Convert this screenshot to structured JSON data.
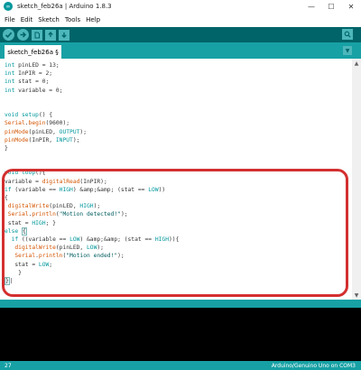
{
  "window": {
    "title": "sketch_feb26a | Arduino 1.8.3",
    "icon_text": "∞",
    "controls": [
      "—",
      "☐",
      "✕"
    ]
  },
  "menu": [
    "File",
    "Edit",
    "Sketch",
    "Tools",
    "Help"
  ],
  "toolbar": {
    "buttons": [
      "verify-icon",
      "upload-icon",
      "new-icon",
      "open-icon",
      "save-icon"
    ],
    "serial_monitor_icon": "magnifier-icon"
  },
  "tab": {
    "label": "sketch_feb26a §",
    "menu_icon": "▼"
  },
  "code_lines": [
    [
      [
        "kw",
        "int"
      ],
      [
        "p",
        " pinLED = 13;"
      ]
    ],
    [
      [
        "kw",
        "int"
      ],
      [
        "p",
        " InPIR = 2;"
      ]
    ],
    [
      [
        "kw",
        "int"
      ],
      [
        "p",
        " stat = 0;"
      ]
    ],
    [
      [
        "kw",
        "int"
      ],
      [
        "p",
        " variable = 0;"
      ]
    ],
    [],
    [],
    [
      [
        "kw",
        "void"
      ],
      [
        "p",
        " "
      ],
      [
        "kw",
        "setup"
      ],
      [
        "p",
        "() {"
      ]
    ],
    [
      [
        "fn",
        "Serial"
      ],
      [
        "p",
        "."
      ],
      [
        "fn",
        "begin"
      ],
      [
        "p",
        "(9600);"
      ]
    ],
    [
      [
        "fn",
        "pinMode"
      ],
      [
        "p",
        "(pinLED, "
      ],
      [
        "ct",
        "OUTPUT"
      ],
      [
        "p",
        ");"
      ]
    ],
    [
      [
        "fn",
        "pinMode"
      ],
      [
        "p",
        "(InPIR, "
      ],
      [
        "ct",
        "INPUT"
      ],
      [
        "p",
        ");"
      ]
    ],
    [
      [
        "p",
        "}"
      ]
    ],
    [],
    [],
    [
      [
        "kw",
        "void"
      ],
      [
        "p",
        " "
      ],
      [
        "kw",
        "loop"
      ],
      [
        "p",
        "(){"
      ]
    ],
    [
      [
        "p",
        "variable = "
      ],
      [
        "fn",
        "digitalRead"
      ],
      [
        "p",
        "(InPIR);"
      ]
    ],
    [
      [
        "kw",
        "if"
      ],
      [
        "p",
        " (variable == "
      ],
      [
        "ct",
        "HIGH"
      ],
      [
        "p",
        ") &amp;&amp; (stat == "
      ],
      [
        "ct",
        "LOW"
      ],
      [
        "p",
        "))"
      ]
    ],
    [
      [
        "p",
        "{"
      ]
    ],
    [
      [
        "p",
        " "
      ],
      [
        "fn",
        "digitalWrite"
      ],
      [
        "p",
        "(pinLED, "
      ],
      [
        "ct",
        "HIGH"
      ],
      [
        "p",
        ");"
      ]
    ],
    [
      [
        "p",
        " "
      ],
      [
        "fn",
        "Serial"
      ],
      [
        "p",
        "."
      ],
      [
        "fn",
        "println"
      ],
      [
        "p",
        "("
      ],
      [
        "str",
        "\"Motion detected!\""
      ],
      [
        "p",
        ");"
      ]
    ],
    [
      [
        "p",
        " stat = "
      ],
      [
        "ct",
        "HIGH"
      ],
      [
        "p",
        "; }"
      ]
    ],
    [
      [
        "kw",
        "else"
      ],
      [
        "p",
        " "
      ],
      [
        "brk",
        "{"
      ]
    ],
    [
      [
        "p",
        "  "
      ],
      [
        "kw",
        "if"
      ],
      [
        "p",
        " ((variable == "
      ],
      [
        "ct",
        "LOW"
      ],
      [
        "p",
        ") &amp;&amp; (stat == "
      ],
      [
        "ct",
        "HIGH"
      ],
      [
        "p",
        ")){"
      ]
    ],
    [
      [
        "p",
        "   "
      ],
      [
        "fn",
        "digitalWrite"
      ],
      [
        "p",
        "(pinLED, "
      ],
      [
        "ct",
        "LOW"
      ],
      [
        "p",
        ");"
      ]
    ],
    [
      [
        "p",
        "   "
      ],
      [
        "fn",
        "Serial"
      ],
      [
        "p",
        "."
      ],
      [
        "fn",
        "println"
      ],
      [
        "p",
        "("
      ],
      [
        "str",
        "\"Motion ended!\""
      ],
      [
        "p",
        ");"
      ]
    ],
    [
      [
        "p",
        "   stat = "
      ],
      [
        "ct",
        "LOW"
      ],
      [
        "p",
        ";"
      ]
    ],
    [
      [
        "p",
        "    }"
      ]
    ],
    [
      [
        "brk",
        "}"
      ],
      [
        "p",
        "|"
      ]
    ]
  ],
  "scroll": {
    "up": "▲",
    "down": "▼"
  },
  "status": {
    "line": "27",
    "board": "Arduino/Genuino Uno on COM3"
  }
}
